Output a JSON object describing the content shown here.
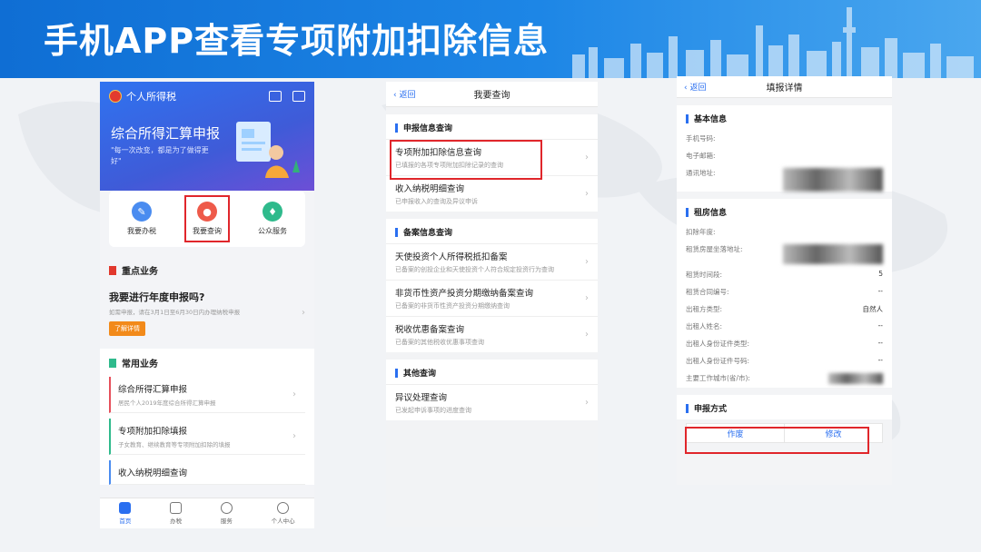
{
  "banner": {
    "title": "手机APP查看专项附加扣除信息"
  },
  "phone1": {
    "app_name": "个人所得税",
    "hero_title": "综合所得汇算申报",
    "hero_sub": "\"每一次改变，都是为了做得更好\"",
    "actions": [
      {
        "label": "我要办税",
        "color": "#4a8cf0"
      },
      {
        "label": "我要查询",
        "color": "#ee5a4a"
      },
      {
        "label": "公众服务",
        "color": "#2fba8c"
      }
    ],
    "key_section": "重点业务",
    "key_title": "我要进行年度申报吗?",
    "key_desc": "如需申报，请在3月1日至6月30日内办理纳税申报",
    "key_btn": "了解详情",
    "common_section": "常用业务",
    "common_items": [
      {
        "title": "综合所得汇算申报",
        "sub": "居民个人2019年度综合所得汇算申报"
      },
      {
        "title": "专项附加扣除填报",
        "sub": "子女教育、继续教育等专项附加扣除的填报"
      },
      {
        "title": "收入纳税明细查询",
        "sub": ""
      }
    ],
    "tabs": [
      "首页",
      "办税",
      "服务",
      "个人中心"
    ]
  },
  "phone2": {
    "back": "返回",
    "title": "我要查询",
    "groups": [
      {
        "head": "申报信息查询",
        "items": [
          {
            "title": "专项附加扣除信息查询",
            "sub": "已填报的各项专项附加扣除记录的查询"
          },
          {
            "title": "收入纳税明细查询",
            "sub": "已申报收入的查询及异议申诉"
          }
        ]
      },
      {
        "head": "备案信息查询",
        "items": [
          {
            "title": "天使投资个人所得税抵扣备案",
            "sub": "已备案的创投企业和天使投资个人符合规定投资行为查询"
          },
          {
            "title": "非货币性资产投资分期缴纳备案查询",
            "sub": "已备案的非货币性资产投资分期缴纳查询"
          },
          {
            "title": "税收优惠备案查询",
            "sub": "已备案的其他税收优惠事项查询"
          }
        ]
      },
      {
        "head": "其他查询",
        "items": [
          {
            "title": "异议处理查询",
            "sub": "已发起申诉事项的进度查询"
          }
        ]
      }
    ]
  },
  "phone3": {
    "back": "返回",
    "title": "填报详情",
    "basic_head": "基本信息",
    "basic_fields": [
      "手机号码:",
      "电子邮箱:",
      "通讯地址:"
    ],
    "rent_head": "租房信息",
    "rent_fields": [
      {
        "label": "扣除年度:",
        "value": ""
      },
      {
        "label": "租赁房屋坐落地址:",
        "value": ""
      },
      {
        "label": "租赁时间段:",
        "value": "5"
      },
      {
        "label": "租赁合同编号:",
        "value": "--"
      },
      {
        "label": "出租方类型:",
        "value": "自然人"
      },
      {
        "label": "出租人姓名:",
        "value": "--"
      },
      {
        "label": "出租人身份证件类型:",
        "value": "--"
      },
      {
        "label": "出租人身份证件号码:",
        "value": "--"
      },
      {
        "label": "主要工作城市(省/市):",
        "value": ""
      }
    ],
    "method_head": "申报方式",
    "btn_void": "作废",
    "btn_edit": "修改"
  }
}
